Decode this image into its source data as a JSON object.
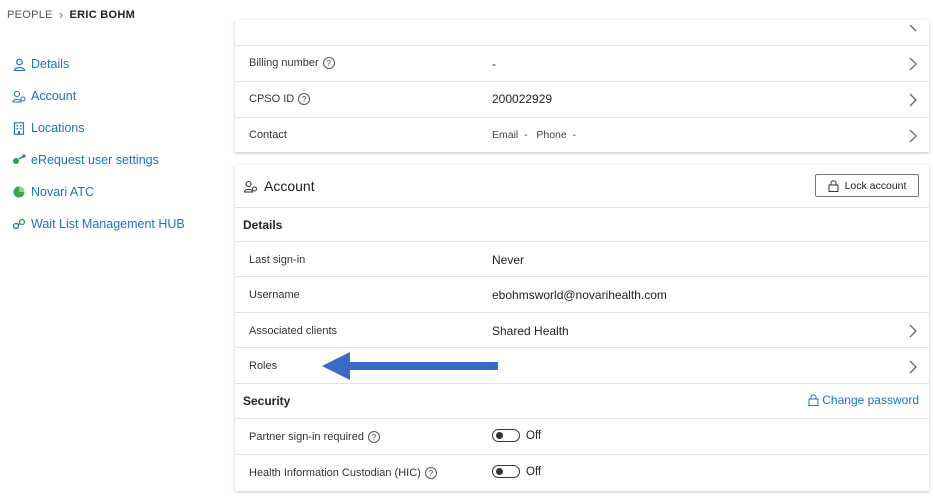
{
  "breadcrumb": {
    "parent": "PEOPLE",
    "current": "ERIC BOHM"
  },
  "sidebar": {
    "items": [
      {
        "label": "Details",
        "icon": "person-icon"
      },
      {
        "label": "Account",
        "icon": "account-icon"
      },
      {
        "label": "Locations",
        "icon": "building-icon"
      },
      {
        "label": "eRequest user settings",
        "icon": "erequest-icon"
      },
      {
        "label": "Novari ATC",
        "icon": "novari-atc-icon"
      },
      {
        "label": "Wait List Management HUB",
        "icon": "hub-icon"
      }
    ]
  },
  "details_card": {
    "rows": [
      {
        "label": "Billing number",
        "value": "-"
      },
      {
        "label": "CPSO ID",
        "value": "200022929"
      },
      {
        "label": "Contact",
        "email_label": "Email",
        "email_value": "-",
        "phone_label": "Phone",
        "phone_value": "-"
      }
    ]
  },
  "account_card": {
    "title": "Account",
    "lock_button": "Lock account",
    "details_heading": "Details",
    "rows": [
      {
        "label": "Last sign-in",
        "value": "Never"
      },
      {
        "label": "Username",
        "value": "ebohmsworld@novarihealth.com"
      },
      {
        "label": "Associated clients",
        "value": "Shared Health"
      },
      {
        "label": "Roles",
        "value": ""
      }
    ],
    "security_heading": "Security",
    "change_password": "Change password",
    "security_rows": [
      {
        "label": "Partner sign-in required",
        "state": "Off"
      },
      {
        "label": "Health Information Custodian (HIC)",
        "state": "Off"
      }
    ]
  },
  "colors": {
    "link": "#1a73c9",
    "arrow": "#3a6bc4"
  }
}
